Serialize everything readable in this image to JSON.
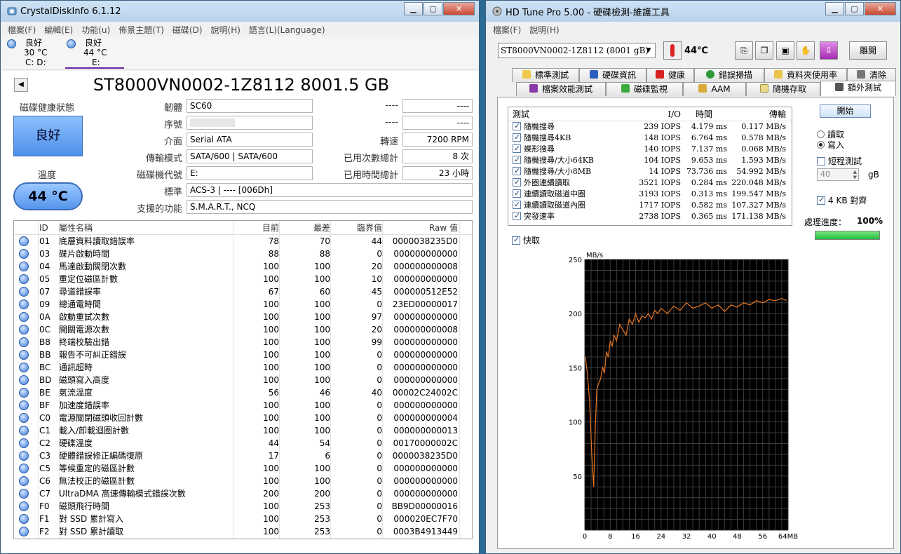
{
  "cdi": {
    "title": "CrystalDiskInfo 6.1.12",
    "menu": [
      "檔案(F)",
      "編輯(E)",
      "功能(u)",
      "佈景主題(T)",
      "磁碟(D)",
      "說明(H)",
      "語言(L)(Language)"
    ],
    "drives": [
      {
        "status": "良好",
        "temp": "30 °C",
        "letter": "C: D:"
      },
      {
        "status": "良好",
        "temp": "44 °C",
        "letter": "E:"
      }
    ],
    "model": "ST8000VN0002-1Z8112 8001.5 GB",
    "health_label": "磁碟健康狀態",
    "health_value": "良好",
    "temp_label": "溫度",
    "temp_value": "44 °C",
    "labels": {
      "firmware": "韌體",
      "serial": "序號",
      "interface": "介面",
      "transfer": "傳輸模式",
      "drive_letter": "磁碟機代號",
      "standard": "標準",
      "features": "支援的功能",
      "rpm": "轉速",
      "power_on_count": "已用次數總計",
      "power_on_hours": "已用時間總計"
    },
    "values": {
      "firmware": "SC60",
      "serial": "",
      "interface": "Serial ATA",
      "transfer": "SATA/600 | SATA/600",
      "drive_letter": "E:",
      "standard": "ACS-3 | ---- [006Dh]",
      "features": "S.M.A.R.T., NCQ",
      "blank1_label": "----",
      "blank1_value": "----",
      "blank2_label": "----",
      "blank2_value": "----",
      "rpm": "7200 RPM",
      "power_on_count": "8 次",
      "power_on_hours": "23 小時"
    },
    "smart_headers": [
      "ID",
      "屬性名稱",
      "目前",
      "最差",
      "臨界值",
      "Raw 值"
    ],
    "smart_rows": [
      [
        "01",
        "底層資料讀取錯誤率",
        "78",
        "70",
        "44",
        "0000038235D0"
      ],
      [
        "03",
        "碟片啟動時間",
        "88",
        "88",
        "0",
        "000000000000"
      ],
      [
        "04",
        "馬達啟動關閉次數",
        "100",
        "100",
        "20",
        "000000000008"
      ],
      [
        "05",
        "重定位磁區計數",
        "100",
        "100",
        "10",
        "000000000000"
      ],
      [
        "07",
        "尋道錯誤率",
        "67",
        "60",
        "45",
        "000000512E52"
      ],
      [
        "09",
        "總通電時間",
        "100",
        "100",
        "0",
        "23ED00000017"
      ],
      [
        "0A",
        "啟動重試次數",
        "100",
        "100",
        "97",
        "000000000000"
      ],
      [
        "0C",
        "開關電源次數",
        "100",
        "100",
        "20",
        "000000000008"
      ],
      [
        "B8",
        "終端校驗出錯",
        "100",
        "100",
        "99",
        "000000000000"
      ],
      [
        "BB",
        "報告不可糾正錯誤",
        "100",
        "100",
        "0",
        "000000000000"
      ],
      [
        "BC",
        "通訊超時",
        "100",
        "100",
        "0",
        "000000000000"
      ],
      [
        "BD",
        "磁頭寫入高度",
        "100",
        "100",
        "0",
        "000000000000"
      ],
      [
        "BE",
        "氣流溫度",
        "56",
        "46",
        "40",
        "00002C24002C"
      ],
      [
        "BF",
        "加速度錯誤率",
        "100",
        "100",
        "0",
        "000000000000"
      ],
      [
        "C0",
        "電源關閉磁頭收回計數",
        "100",
        "100",
        "0",
        "000000000004"
      ],
      [
        "C1",
        "載入/卸載迴圈計數",
        "100",
        "100",
        "0",
        "000000000013"
      ],
      [
        "C2",
        "硬碟溫度",
        "44",
        "54",
        "0",
        "00170000002C"
      ],
      [
        "C3",
        "硬體錯誤修正編碼復原",
        "17",
        "6",
        "0",
        "0000038235D0"
      ],
      [
        "C5",
        "等候重定的磁區計數",
        "100",
        "100",
        "0",
        "000000000000"
      ],
      [
        "C6",
        "無法校正的磁區計數",
        "100",
        "100",
        "0",
        "000000000000"
      ],
      [
        "C7",
        "UltraDMA 高速傳輸模式錯誤次數",
        "200",
        "200",
        "0",
        "000000000000"
      ],
      [
        "F0",
        "磁頭飛行時間",
        "100",
        "253",
        "0",
        "BB9D00000016"
      ],
      [
        "F1",
        "對 SSD 累計寫入",
        "100",
        "253",
        "0",
        "000020EC7F70"
      ],
      [
        "F2",
        "對 SSD 累計讀取",
        "100",
        "253",
        "0",
        "0003B4913449"
      ]
    ]
  },
  "hdt": {
    "title": "HD Tune Pro  5.00 - 硬碟檢測-維護工具",
    "menu": [
      "檔案(F)",
      "說明(H)"
    ],
    "drive": "ST8000VN0002-1Z8112 (8001 gB)",
    "temp": "44℃",
    "close_label": "離開",
    "tabs_row1": [
      "標準測試",
      "硬碟資訊",
      "健康",
      "錯誤掃描",
      "資料夾使用率",
      "清除"
    ],
    "tabs_row2": [
      "檔案效能測試",
      "磁碟監視",
      "AAM",
      "隨機存取",
      "額外測試"
    ],
    "list_headers": [
      "測試",
      "I/O",
      "時間",
      "傳輸"
    ],
    "tests": [
      [
        "隨機搜尋",
        "239 IOPS",
        "4.179 ms",
        "0.117 MB/s"
      ],
      [
        "隨機搜尋4KB",
        "148 IOPS",
        "6.764 ms",
        "0.578 MB/s"
      ],
      [
        "蝶形搜尋",
        "140 IOPS",
        "7.137 ms",
        "0.068 MB/s"
      ],
      [
        "隨機搜尋/大小64KB",
        "104 IOPS",
        "9.653 ms",
        "1.593 MB/s"
      ],
      [
        "隨機搜尋/大小8MB",
        "14 IOPS",
        "73.736 ms",
        "54.992 MB/s"
      ],
      [
        "外圈連續讀取",
        "3521 IOPS",
        "0.284 ms",
        "220.048 MB/s"
      ],
      [
        "連續讀取磁道中圈",
        "3193 IOPS",
        "0.313 ms",
        "199.547 MB/s"
      ],
      [
        "連續讀取磁道內圈",
        "1717 IOPS",
        "0.582 ms",
        "107.327 MB/s"
      ],
      [
        "突發速率",
        "2738 IOPS",
        "0.365 ms",
        "171.138 MB/s"
      ]
    ],
    "start_label": "開始",
    "read_label": "讀取",
    "write_label": "寫入",
    "short_test_label": "短程測試",
    "short_test_value": "40",
    "short_test_unit": "gB",
    "align_label": "4 KB 對齊",
    "progress_label": "處理進度：",
    "progress_value": "100%",
    "quick_label": "快取"
  },
  "chart_data": {
    "type": "line",
    "title": "",
    "ylabel": "MB/s",
    "xlabel": "MB",
    "xlim": [
      0,
      64
    ],
    "ylim": [
      0,
      250
    ],
    "x_ticks": [
      "0",
      "8",
      "16",
      "24",
      "32",
      "40",
      "48",
      "56",
      "64MB"
    ],
    "y_ticks": [
      "250",
      "200",
      "150",
      "100",
      "50"
    ],
    "series": [
      {
        "color": "#e87722",
        "x": [
          0.2,
          0.8,
          1.5,
          2.2,
          2.8,
          3.3,
          3.8,
          4.3,
          5.0,
          5.6,
          6.2,
          6.8,
          7.4,
          8.0,
          8.6,
          9.2,
          10,
          11,
          12,
          13,
          14,
          15,
          16,
          17,
          18,
          19,
          20,
          21,
          22,
          23,
          24,
          26,
          28,
          30,
          32,
          34,
          36,
          38,
          40,
          42,
          44,
          46,
          48,
          50,
          52,
          54,
          56,
          58,
          60,
          62,
          63.5
        ],
        "y": [
          160,
          145,
          120,
          70,
          40,
          95,
          130,
          135,
          140,
          150,
          145,
          165,
          160,
          175,
          170,
          180,
          175,
          190,
          185,
          180,
          195,
          190,
          200,
          192,
          198,
          196,
          200,
          195,
          203,
          200,
          205,
          200,
          207,
          203,
          210,
          205,
          207,
          210,
          205,
          208,
          202,
          208,
          206,
          210,
          208,
          212,
          210,
          213,
          212,
          214,
          212
        ]
      }
    ]
  }
}
